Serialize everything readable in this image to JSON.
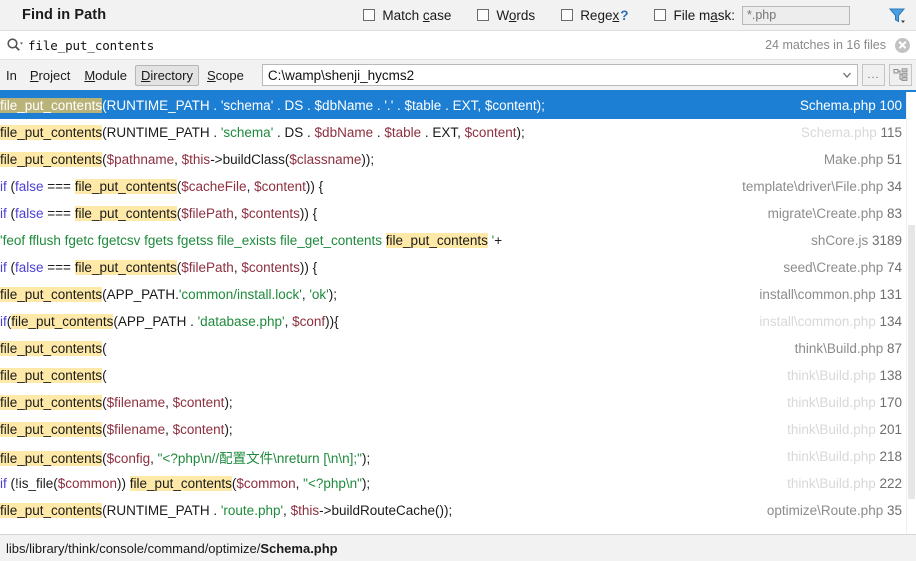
{
  "header": {
    "title": "Find in Path",
    "options": [
      {
        "name": "match-case",
        "label_pre": "Match ",
        "label_mn": "c",
        "label_post": "ase",
        "checked": false
      },
      {
        "name": "words",
        "label_pre": "W",
        "label_mn": "o",
        "label_post": "rds",
        "checked": false
      },
      {
        "name": "regex",
        "label_pre": "Rege",
        "label_mn": "x",
        "label_post": "",
        "suffix": "?",
        "checked": false
      },
      {
        "name": "file-mask",
        "label_pre": "File m",
        "label_mn": "a",
        "label_post": "sk:",
        "checked": false
      }
    ],
    "file_mask_placeholder": "*.php",
    "file_mask_value": "",
    "filter_icon": "filter-funnel-icon"
  },
  "search": {
    "icon": "search-icon",
    "query": "file_put_contents",
    "matches_summary": "24 matches in 16 files",
    "clear_icon": "clear-icon"
  },
  "scope": {
    "in_label": "In",
    "tabs": [
      {
        "label_pre": "",
        "label_mn": "P",
        "label_post": "roject",
        "selected": false,
        "name": "scope-tab-project"
      },
      {
        "label_pre": "",
        "label_mn": "M",
        "label_post": "odule",
        "selected": false,
        "name": "scope-tab-module"
      },
      {
        "label_pre": "",
        "label_mn": "D",
        "label_post": "irectory",
        "selected": true,
        "name": "scope-tab-directory"
      },
      {
        "label_pre": "",
        "label_mn": "S",
        "label_post": "cope",
        "selected": false,
        "name": "scope-tab-scope"
      }
    ],
    "directory_value": "C:\\wamp\\shenji_hycms2",
    "browse_button_label": "...",
    "tree_button_icon": "module-tree-icon",
    "dropdown_icon": "chevron-down-icon"
  },
  "results": {
    "rows": [
      {
        "selected": true,
        "tokens": [
          {
            "t": "hl",
            "v": "file_put_contents"
          },
          {
            "t": "plain",
            "v": "(RUNTIME_PATH . "
          },
          {
            "t": "str",
            "v": "'schema'"
          },
          {
            "t": "plain",
            "v": " . DS . "
          },
          {
            "t": "var",
            "v": "$dbName"
          },
          {
            "t": "plain",
            "v": " . "
          },
          {
            "t": "str",
            "v": "'.'"
          },
          {
            "t": "plain",
            "v": " . "
          },
          {
            "t": "var",
            "v": "$table"
          },
          {
            "t": "plain",
            "v": " . EXT, "
          },
          {
            "t": "var",
            "v": "$content"
          },
          {
            "t": "plain",
            "v": ");"
          }
        ],
        "file": "Schema.php",
        "line": "100",
        "dim": false
      },
      {
        "selected": false,
        "tokens": [
          {
            "t": "hl",
            "v": "file_put_contents"
          },
          {
            "t": "plain",
            "v": "(RUNTIME_PATH . "
          },
          {
            "t": "str",
            "v": "'schema'"
          },
          {
            "t": "plain",
            "v": " . DS . "
          },
          {
            "t": "var",
            "v": "$dbName"
          },
          {
            "t": "plain",
            "v": " . "
          },
          {
            "t": "var",
            "v": "$table"
          },
          {
            "t": "plain",
            "v": " . EXT, "
          },
          {
            "t": "var",
            "v": "$content"
          },
          {
            "t": "plain",
            "v": ");"
          }
        ],
        "file": "Schema.php",
        "line": "115",
        "dim": true
      },
      {
        "selected": false,
        "tokens": [
          {
            "t": "hl",
            "v": "file_put_contents"
          },
          {
            "t": "plain",
            "v": "("
          },
          {
            "t": "var",
            "v": "$pathname"
          },
          {
            "t": "plain",
            "v": ", "
          },
          {
            "t": "var",
            "v": "$this"
          },
          {
            "t": "plain",
            "v": "->buildClass("
          },
          {
            "t": "var",
            "v": "$classname"
          },
          {
            "t": "plain",
            "v": "));"
          }
        ],
        "file": "Make.php",
        "line": "51",
        "dim": false
      },
      {
        "selected": false,
        "tokens": [
          {
            "t": "kw",
            "v": "if"
          },
          {
            "t": "plain",
            "v": " ("
          },
          {
            "t": "kw",
            "v": "false"
          },
          {
            "t": "plain",
            "v": " === "
          },
          {
            "t": "hl",
            "v": "file_put_contents"
          },
          {
            "t": "plain",
            "v": "("
          },
          {
            "t": "var",
            "v": "$cacheFile"
          },
          {
            "t": "plain",
            "v": ", "
          },
          {
            "t": "var",
            "v": "$content"
          },
          {
            "t": "plain",
            "v": ")) {"
          }
        ],
        "file": "template\\driver\\File.php",
        "line": "34",
        "dim": false
      },
      {
        "selected": false,
        "tokens": [
          {
            "t": "kw",
            "v": "if"
          },
          {
            "t": "plain",
            "v": " ("
          },
          {
            "t": "kw",
            "v": "false"
          },
          {
            "t": "plain",
            "v": " === "
          },
          {
            "t": "hl",
            "v": "file_put_contents"
          },
          {
            "t": "plain",
            "v": "("
          },
          {
            "t": "var",
            "v": "$filePath"
          },
          {
            "t": "plain",
            "v": ", "
          },
          {
            "t": "var",
            "v": "$contents"
          },
          {
            "t": "plain",
            "v": ")) {"
          }
        ],
        "file": "migrate\\Create.php",
        "line": "83",
        "dim": false
      },
      {
        "selected": false,
        "tokens": [
          {
            "t": "str",
            "v": "'feof fflush fgetc fgetcsv fgets fgetss file_exists file_get_contents "
          },
          {
            "t": "hl",
            "v": "file_put_contents"
          },
          {
            "t": "str",
            "v": " '"
          },
          {
            "t": "plain",
            "v": "+"
          }
        ],
        "file": "shCore.js",
        "line": "3189",
        "dim": false
      },
      {
        "selected": false,
        "tokens": [
          {
            "t": "kw",
            "v": "if"
          },
          {
            "t": "plain",
            "v": " ("
          },
          {
            "t": "kw",
            "v": "false"
          },
          {
            "t": "plain",
            "v": " === "
          },
          {
            "t": "hl",
            "v": "file_put_contents"
          },
          {
            "t": "plain",
            "v": "("
          },
          {
            "t": "var",
            "v": "$filePath"
          },
          {
            "t": "plain",
            "v": ", "
          },
          {
            "t": "var",
            "v": "$contents"
          },
          {
            "t": "plain",
            "v": ")) {"
          }
        ],
        "file": "seed\\Create.php",
        "line": "74",
        "dim": false
      },
      {
        "selected": false,
        "tokens": [
          {
            "t": "hl",
            "v": "file_put_contents"
          },
          {
            "t": "plain",
            "v": "(APP_PATH."
          },
          {
            "t": "str",
            "v": "'common/install.lock'"
          },
          {
            "t": "plain",
            "v": ", "
          },
          {
            "t": "str",
            "v": "'ok'"
          },
          {
            "t": "plain",
            "v": ");"
          }
        ],
        "file": "install\\common.php",
        "line": "131",
        "dim": false
      },
      {
        "selected": false,
        "tokens": [
          {
            "t": "kw",
            "v": "if"
          },
          {
            "t": "plain",
            "v": "("
          },
          {
            "t": "hl",
            "v": "file_put_contents"
          },
          {
            "t": "plain",
            "v": "(APP_PATH . "
          },
          {
            "t": "str",
            "v": "'database.php'"
          },
          {
            "t": "plain",
            "v": ", "
          },
          {
            "t": "var",
            "v": "$conf"
          },
          {
            "t": "plain",
            "v": ")){"
          }
        ],
        "file": "install\\common.php",
        "line": "134",
        "dim": true
      },
      {
        "selected": false,
        "tokens": [
          {
            "t": "hl",
            "v": "file_put_contents"
          },
          {
            "t": "plain",
            "v": "("
          }
        ],
        "file": "think\\Build.php",
        "line": "87",
        "dim": false
      },
      {
        "selected": false,
        "tokens": [
          {
            "t": "hl",
            "v": "file_put_contents"
          },
          {
            "t": "plain",
            "v": "("
          }
        ],
        "file": "think\\Build.php",
        "line": "138",
        "dim": true
      },
      {
        "selected": false,
        "tokens": [
          {
            "t": "hl",
            "v": "file_put_contents"
          },
          {
            "t": "plain",
            "v": "("
          },
          {
            "t": "var",
            "v": "$filename"
          },
          {
            "t": "plain",
            "v": ", "
          },
          {
            "t": "var",
            "v": "$content"
          },
          {
            "t": "plain",
            "v": ");"
          }
        ],
        "file": "think\\Build.php",
        "line": "170",
        "dim": true
      },
      {
        "selected": false,
        "tokens": [
          {
            "t": "hl",
            "v": "file_put_contents"
          },
          {
            "t": "plain",
            "v": "("
          },
          {
            "t": "var",
            "v": "$filename"
          },
          {
            "t": "plain",
            "v": ", "
          },
          {
            "t": "var",
            "v": "$content"
          },
          {
            "t": "plain",
            "v": ");"
          }
        ],
        "file": "think\\Build.php",
        "line": "201",
        "dim": true
      },
      {
        "selected": false,
        "tokens": [
          {
            "t": "hl",
            "v": "file_put_contents"
          },
          {
            "t": "plain",
            "v": "("
          },
          {
            "t": "var",
            "v": "$config"
          },
          {
            "t": "plain",
            "v": ", "
          },
          {
            "t": "str",
            "v": "\"<?php\\n//配置文件\\nreturn [\\n\\n];\""
          },
          {
            "t": "plain",
            "v": ");"
          }
        ],
        "file": "think\\Build.php",
        "line": "218",
        "dim": true
      },
      {
        "selected": false,
        "tokens": [
          {
            "t": "kw",
            "v": "if"
          },
          {
            "t": "plain",
            "v": " (!is_file("
          },
          {
            "t": "var",
            "v": "$common"
          },
          {
            "t": "plain",
            "v": ")) "
          },
          {
            "t": "hl",
            "v": "file_put_contents"
          },
          {
            "t": "plain",
            "v": "("
          },
          {
            "t": "var",
            "v": "$common"
          },
          {
            "t": "plain",
            "v": ", "
          },
          {
            "t": "str",
            "v": "\"<?php\\n\""
          },
          {
            "t": "plain",
            "v": ");"
          }
        ],
        "file": "think\\Build.php",
        "line": "222",
        "dim": true
      },
      {
        "selected": false,
        "tokens": [
          {
            "t": "hl",
            "v": "file_put_contents"
          },
          {
            "t": "plain",
            "v": "(RUNTIME_PATH . "
          },
          {
            "t": "str",
            "v": "'route.php'"
          },
          {
            "t": "plain",
            "v": ", "
          },
          {
            "t": "var",
            "v": "$this"
          },
          {
            "t": "plain",
            "v": "->buildRouteCache());"
          }
        ],
        "file": "optimize\\Route.php",
        "line": "35",
        "dim": false
      }
    ]
  },
  "status": {
    "path_prefix": "libs/library/think/console/command/optimize/",
    "path_file": "Schema.php"
  },
  "colors": {
    "selection": "#1c7fd4",
    "match_highlight": "#ffe9a8",
    "match_highlight_selected": "#b9b37a",
    "string": "#1e8a3c",
    "keyword": "#4b3fd6",
    "variable": "#8d2f3f",
    "accent": "#1c7fd4"
  }
}
